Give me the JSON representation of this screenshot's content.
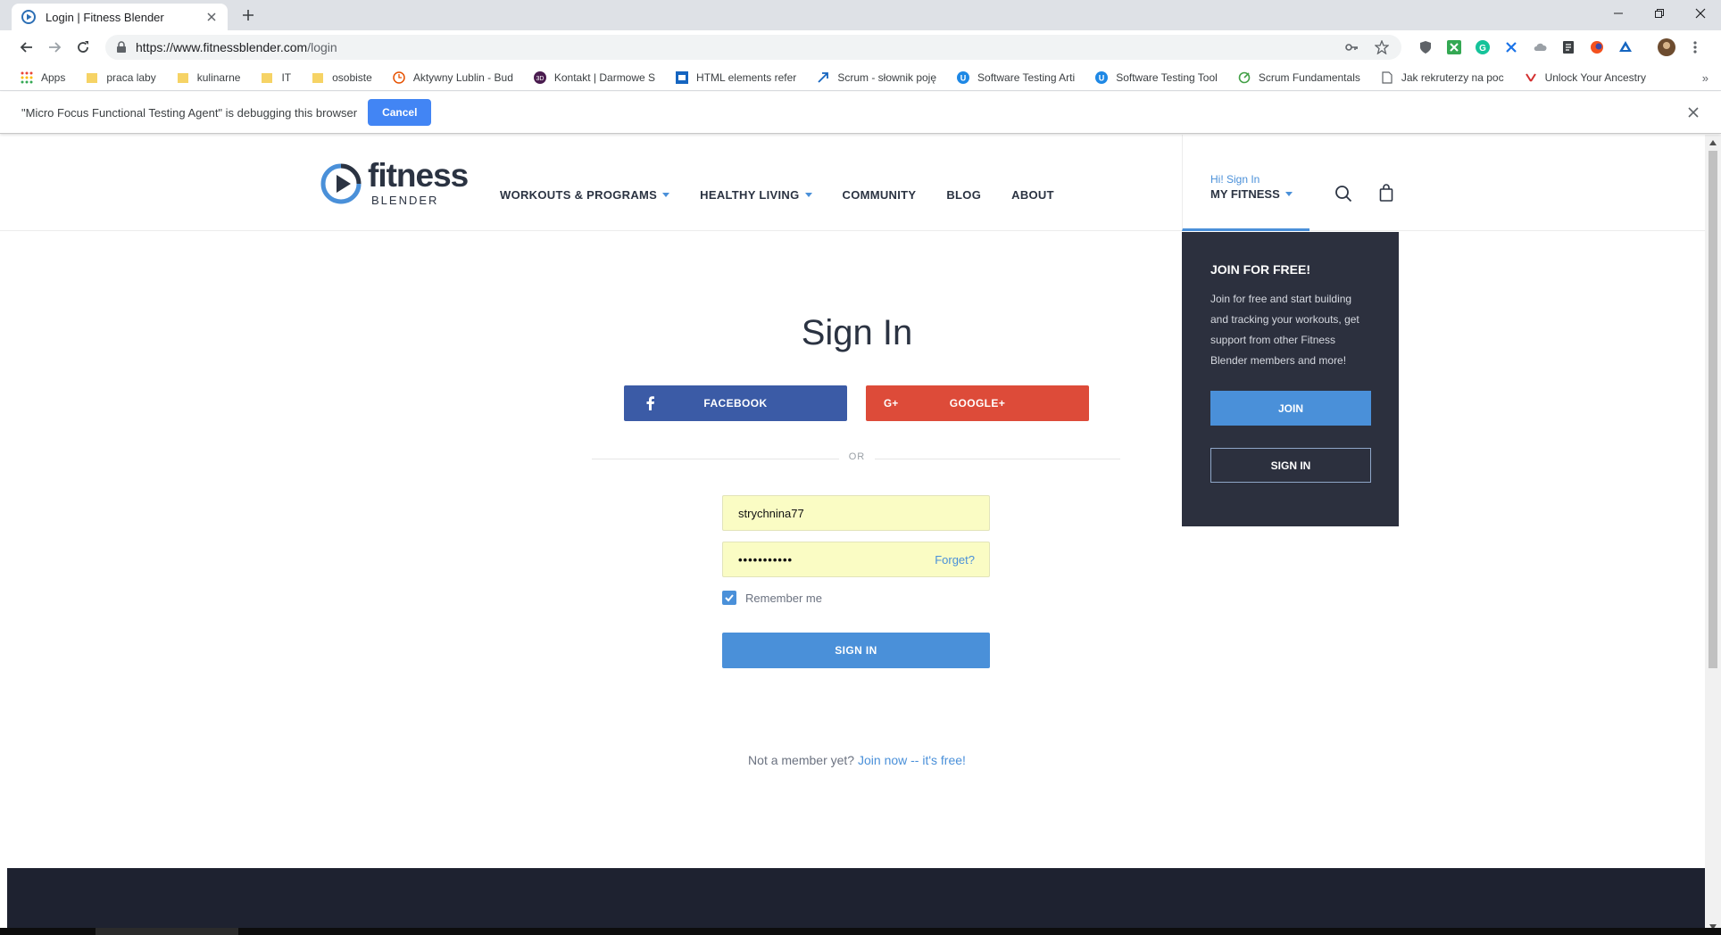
{
  "browser": {
    "tab_title": "Login | Fitness Blender",
    "url_host": "https://www.fitnessblender.com",
    "url_path": "/login",
    "bookmarks": [
      {
        "label": "Apps",
        "icon": "apps-grid-icon"
      },
      {
        "label": "praca laby",
        "icon": "folder-icon"
      },
      {
        "label": "kulinarne",
        "icon": "folder-icon"
      },
      {
        "label": "IT",
        "icon": "folder-icon"
      },
      {
        "label": "osobiste",
        "icon": "folder-icon"
      },
      {
        "label": "Aktywny Lublin - Bud",
        "icon": "site-icon"
      },
      {
        "label": "Kontakt | Darmowe S",
        "icon": "site-icon"
      },
      {
        "label": "HTML elements refer",
        "icon": "site-icon"
      },
      {
        "label": "Scrum - słownik poję",
        "icon": "site-icon"
      },
      {
        "label": "Software Testing Arti",
        "icon": "site-icon"
      },
      {
        "label": "Software Testing Tool",
        "icon": "site-icon"
      },
      {
        "label": "Scrum Fundamentals",
        "icon": "site-icon"
      },
      {
        "label": "Jak rekruterzy na poc",
        "icon": "page-icon"
      },
      {
        "label": "Unlock Your Ancestry",
        "icon": "site-icon"
      }
    ],
    "bookmarks_more": "»",
    "debug_message": "\"Micro Focus Functional Testing Agent\" is debugging this browser",
    "debug_cancel": "Cancel"
  },
  "header": {
    "logo_word": "fitness",
    "logo_sub": "BLENDER",
    "nav": [
      {
        "label": "WORKOUTS & PROGRAMS",
        "has_caret": true
      },
      {
        "label": "HEALTHY LIVING",
        "has_caret": true
      },
      {
        "label": "COMMUNITY",
        "has_caret": false
      },
      {
        "label": "BLOG",
        "has_caret": false
      },
      {
        "label": "ABOUT",
        "has_caret": false
      }
    ],
    "greeting": "Hi! Sign In",
    "my_fitness": "MY FITNESS"
  },
  "join_panel": {
    "title": "JOIN FOR FREE!",
    "text": "Join for free and start building and tracking your workouts, get support from other Fitness Blender members and more!",
    "join_label": "JOIN",
    "signin_label": "SIGN IN"
  },
  "signin": {
    "title": "Sign In",
    "facebook_label": "FACEBOOK",
    "google_label": "GOOGLE+",
    "or_text": "OR",
    "username_value": "strychnina77",
    "password_value": "•••••••••••",
    "forget_label": "Forget?",
    "remember_label": "Remember me",
    "remember_checked": true,
    "submit_label": "SIGN IN",
    "member_text": "Not a member yet?",
    "join_link": "Join now -- it's free!"
  },
  "colors": {
    "accent": "#4a90d9",
    "facebook": "#3b5ba6",
    "google": "#dd4b39",
    "panel": "#2c303e",
    "footer": "#1e2230",
    "autofill": "#fafcc4"
  }
}
